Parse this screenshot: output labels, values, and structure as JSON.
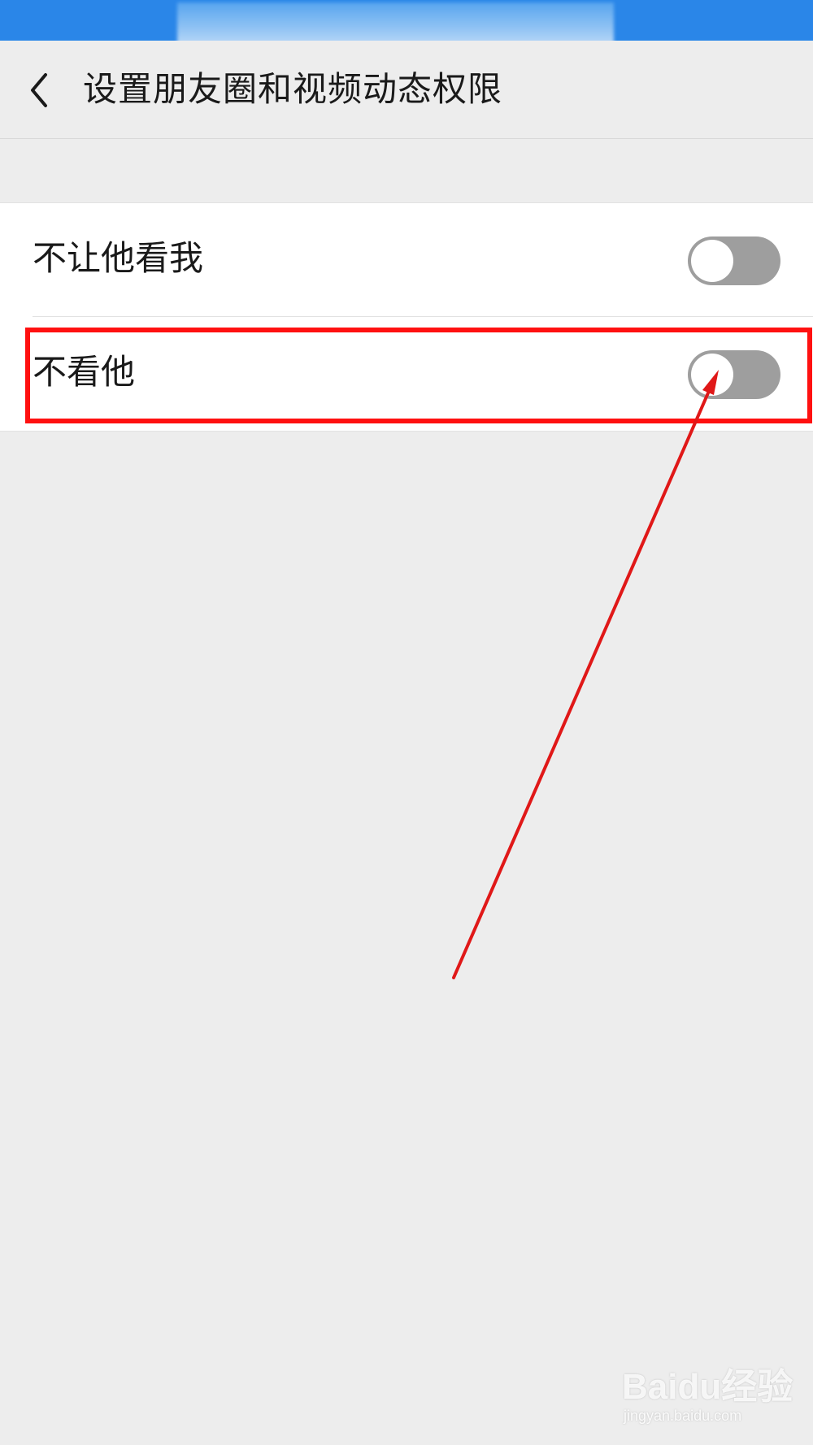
{
  "header": {
    "title": "设置朋友圈和视频动态权限",
    "back_icon": "chevron-left-icon"
  },
  "settings": [
    {
      "label": "不让他看我",
      "toggle_on": false
    },
    {
      "label": "不看他",
      "toggle_on": false
    }
  ],
  "annotation": {
    "highlight_color": "#ff1010",
    "arrow_color": "#e01818"
  },
  "watermark": {
    "text": "Baidu经验",
    "sub": "jingyan.baidu.com"
  },
  "colors": {
    "status_bar": "#2a86e8",
    "background": "#ededed",
    "toggle_off": "#9e9e9e"
  }
}
